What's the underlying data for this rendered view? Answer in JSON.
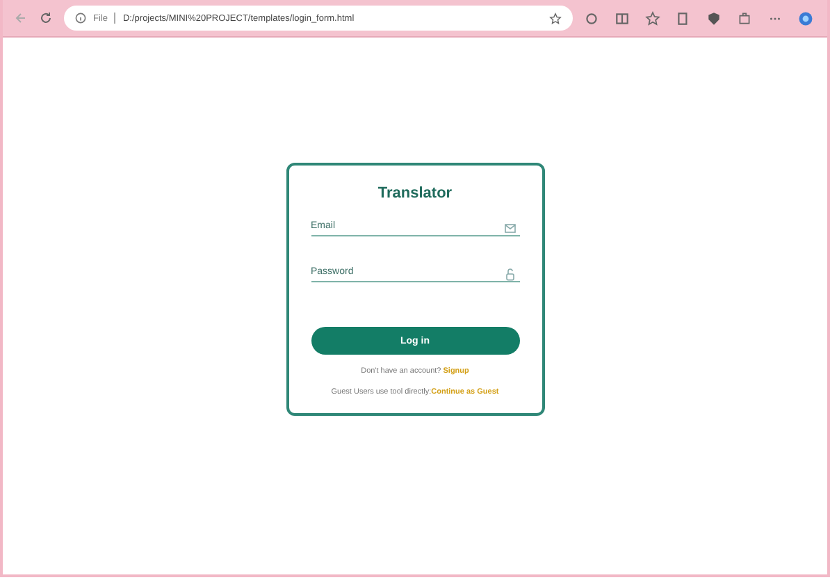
{
  "browser": {
    "file_label": "File",
    "url": "D:/projects/MINI%20PROJECT/templates/login_form.html"
  },
  "login": {
    "title": "Translator",
    "fields": [
      {
        "placeholder": "Email",
        "kind": "email"
      },
      {
        "placeholder": "Password",
        "kind": "password"
      }
    ],
    "submit": "Log in",
    "signup_prompt": "Don't have an account?",
    "signup_link": "Signup",
    "guest_prompt": "Guest Users use tool directly:",
    "guest_link": "Continue as Guest"
  }
}
